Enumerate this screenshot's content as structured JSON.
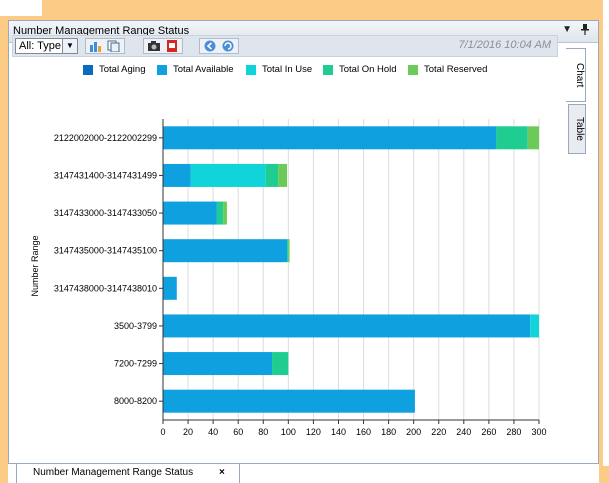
{
  "window": {
    "title": "Number Management Range Status",
    "dropdown_icon": "▼",
    "pin_icon": "pin-icon"
  },
  "toolbar": {
    "type_select_value": "All: Type",
    "timestamp": "7/1/2016 10:04 AM"
  },
  "side_tabs": {
    "chart": "Chart",
    "table": "Table"
  },
  "bottom_tab": {
    "label": "Number Management Range Status",
    "close": "×"
  },
  "colors": {
    "total_aging": "#0a6bbd",
    "total_available": "#0fa0e0",
    "total_in_use": "#11d3da",
    "total_on_hold": "#1fcd91",
    "total_reserved": "#6ccb58"
  },
  "chart_data": {
    "type": "bar",
    "orientation": "horizontal",
    "stacked": true,
    "ylabel": "Number Range",
    "xlim": [
      0,
      300
    ],
    "xticks": [
      0,
      20,
      40,
      60,
      80,
      100,
      120,
      140,
      160,
      180,
      200,
      220,
      240,
      260,
      280,
      300
    ],
    "grid": true,
    "legend_position": "top",
    "categories": [
      "2122002000-2122002299",
      "3147431400-3147431499",
      "3147433000-3147433050",
      "3147435000-3147435100",
      "3147438000-3147438010",
      "3500-3799",
      "7200-7299",
      "8000-8200"
    ],
    "series": [
      {
        "name": "Total Aging",
        "values": [
          0,
          0,
          0,
          0,
          0,
          0,
          0,
          0
        ]
      },
      {
        "name": "Total Available",
        "values": [
          266,
          22,
          43,
          99,
          11,
          293,
          87,
          201
        ]
      },
      {
        "name": "Total In Use",
        "values": [
          0,
          60,
          0,
          0,
          0,
          7,
          0,
          0
        ]
      },
      {
        "name": "Total On Hold",
        "values": [
          25,
          10,
          5,
          1,
          0,
          0,
          13,
          0
        ]
      },
      {
        "name": "Total Reserved",
        "values": [
          9,
          7,
          3,
          1,
          0,
          0,
          0,
          0
        ]
      }
    ]
  }
}
